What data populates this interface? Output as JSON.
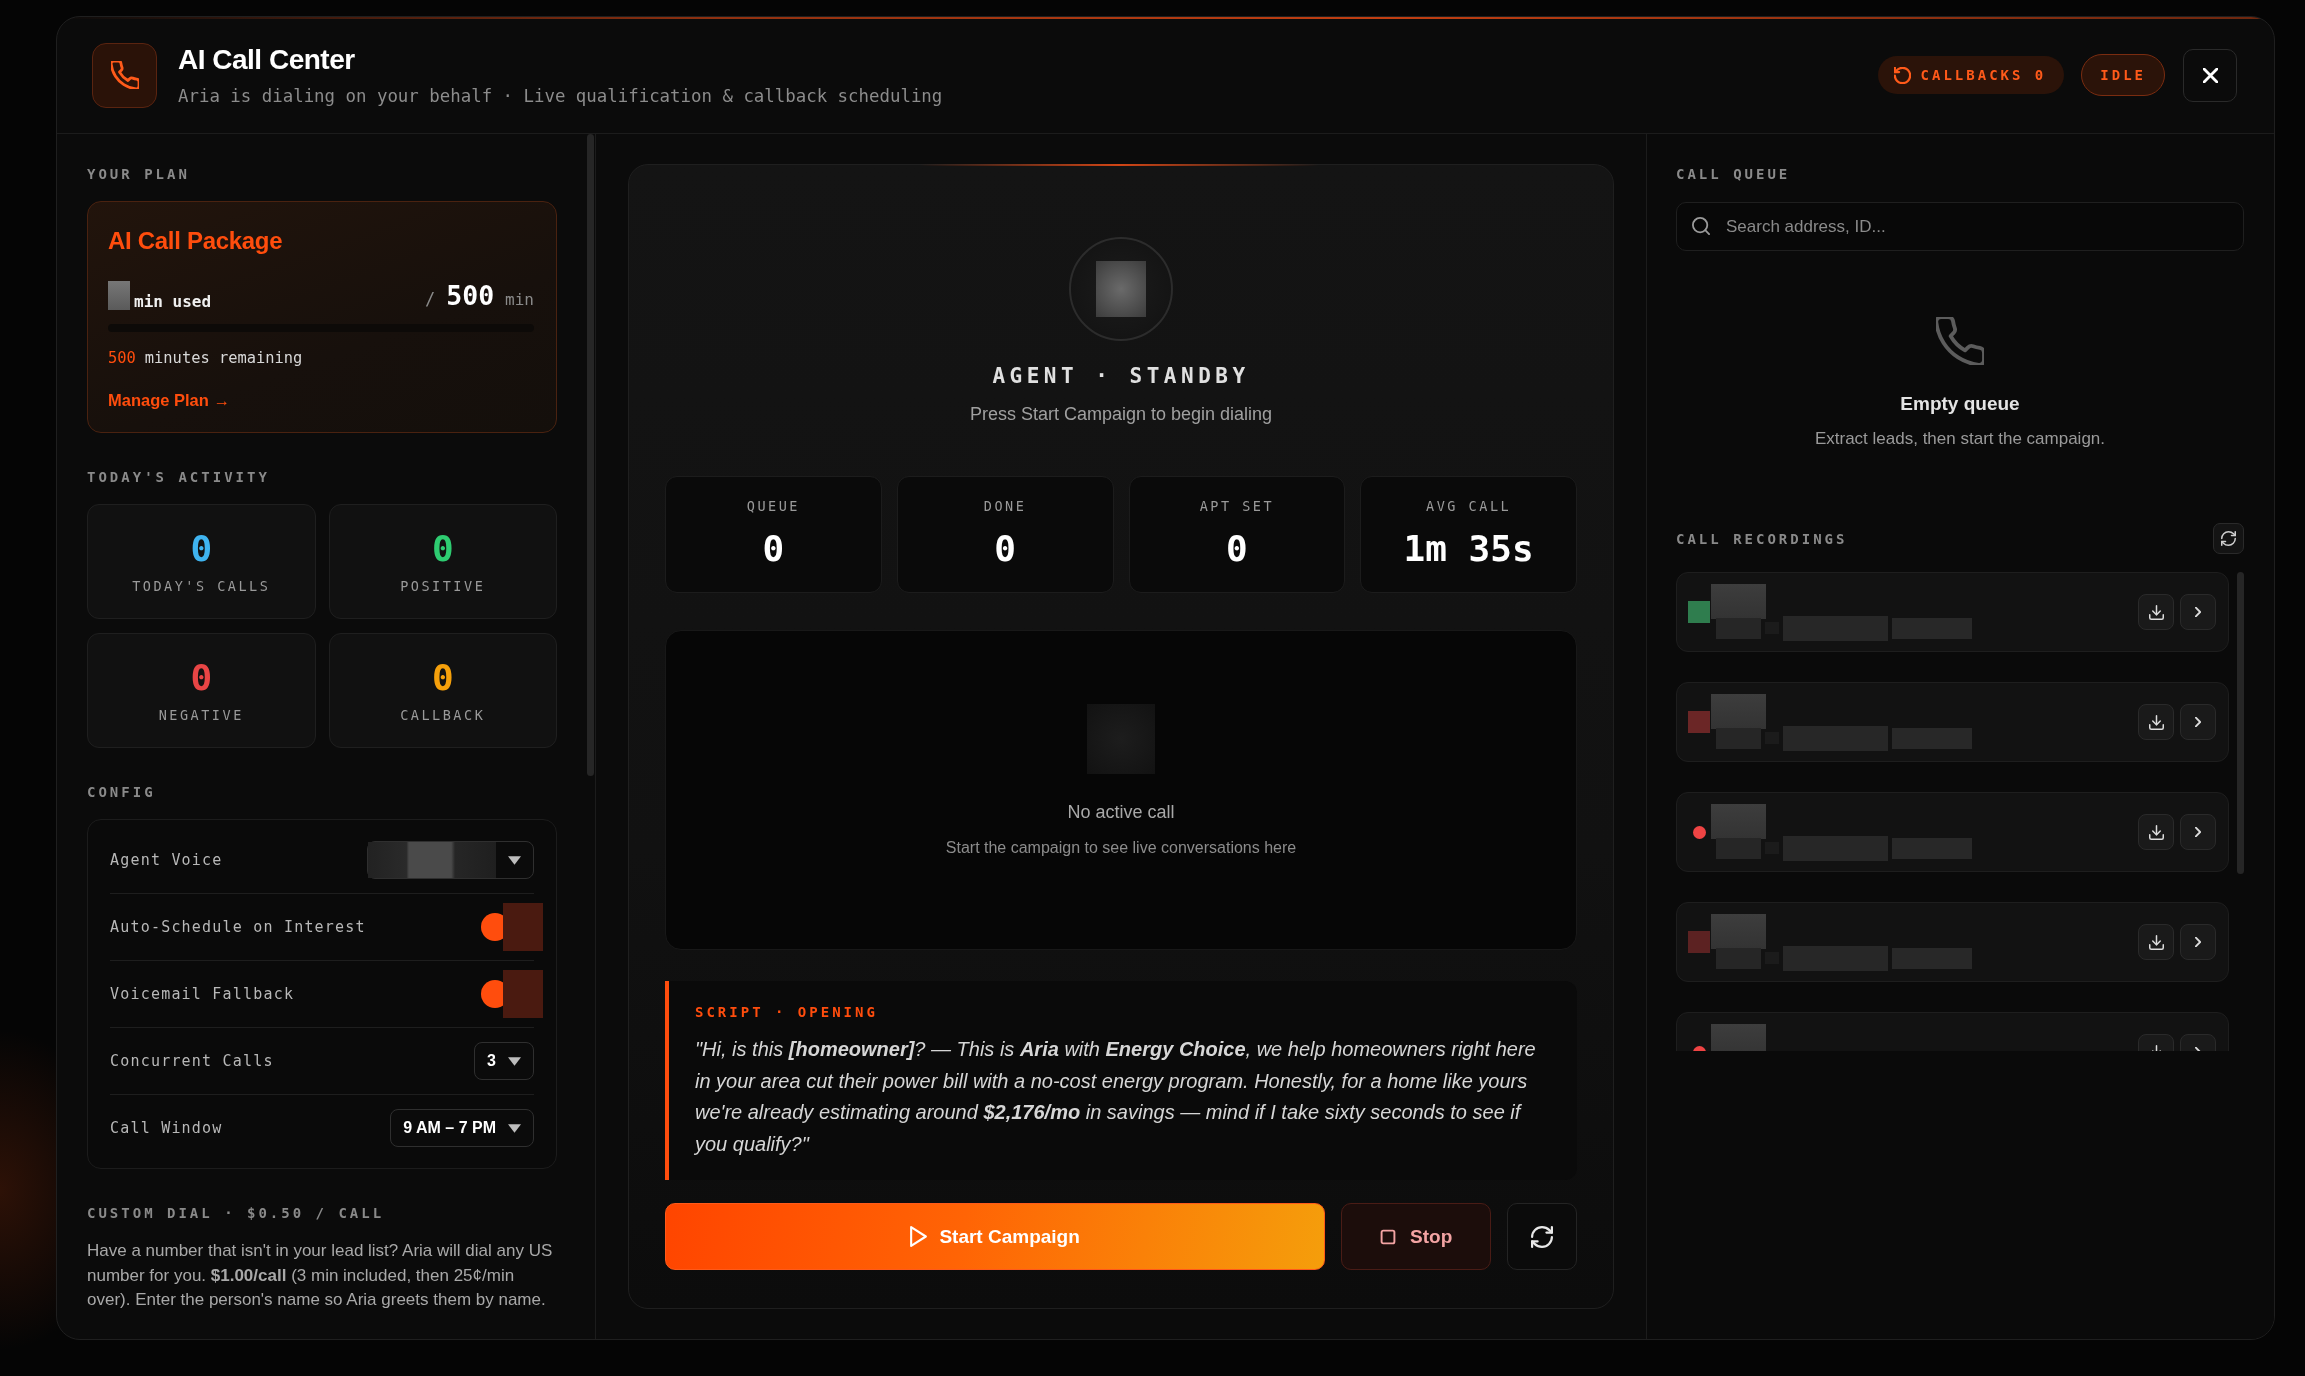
{
  "header": {
    "title": "AI Call Center",
    "subtitle": "Aria is dialing on your behalf · Live qualification & callback scheduling",
    "callbacks": "CALLBACKS 0",
    "status": "IDLE"
  },
  "plan": {
    "section_label": "YOUR PLAN",
    "name": "AI Call Package",
    "used_label": "min used",
    "separator": "/",
    "total": "500",
    "unit": "min",
    "level": 0,
    "remaining_count": "500",
    "remaining_label": "minutes remaining",
    "link": "Manage Plan →"
  },
  "activity": {
    "section_label": "TODAY'S ACTIVITY",
    "stats": [
      {
        "value": "0",
        "label": "TODAY'S CALLS",
        "color": "#3fb4f0"
      },
      {
        "value": "0",
        "label": "POSITIVE",
        "color": "#2ecc71"
      },
      {
        "value": "0",
        "label": "NEGATIVE",
        "color": "#e84545"
      },
      {
        "value": "0",
        "label": "CALLBACK",
        "color": "#f5a00b"
      }
    ]
  },
  "config": {
    "section_label": "CONFIG",
    "rows": [
      {
        "kind": "select",
        "label": "Agent Voice"
      },
      {
        "kind": "toggle",
        "label": "Auto-Schedule on Interest",
        "on": true
      },
      {
        "kind": "toggle",
        "label": "Voicemail Fallback",
        "on": true
      },
      {
        "kind": "select",
        "label": "Concurrent Calls",
        "value": "3"
      },
      {
        "kind": "select",
        "label": "Call Window",
        "value": "9 AM – 7 PM"
      }
    ]
  },
  "custom_dial": {
    "section_label": "CUSTOM DIAL · $0.50 / CALL",
    "description": "Have a number that isn't in your lead list? Aria will dial any US number for you. **$1.00/call** (3 min included, then 25¢/min over). Enter the person's name so Aria greets them by name."
  },
  "agent": {
    "status": "AGENT · STANDBY",
    "hint": "Press Start Campaign to begin dialing"
  },
  "metrics": [
    {
      "label": "QUEUE",
      "value": "0"
    },
    {
      "label": "DONE",
      "value": "0"
    },
    {
      "label": "APT SET",
      "value": "0"
    },
    {
      "label": "AVG CALL",
      "value": "1m 35s"
    }
  ],
  "live_call": {
    "title": "No active call",
    "hint": "Start the campaign to see live conversations here"
  },
  "script": {
    "label": "SCRIPT · OPENING",
    "text": "\"Hi, is this **[homeowner]**? — This is **Aria** with **Energy Choice**, we help homeowners right here in your area cut their power bill with a no-cost energy program. Honestly, for a home like yours we're already estimating around **$2,176/mo** in savings — mind if I take sixty seconds to see if you qualify?\""
  },
  "actions": [
    {
      "kind": "start",
      "label": "Start Campaign"
    },
    {
      "kind": "stop",
      "label": "Stop"
    },
    {
      "kind": "reset"
    }
  ],
  "queue": {
    "section_label": "CALL QUEUE",
    "search_placeholder": "Search address, ID...",
    "empty_title": "Empty queue",
    "empty_hint": "Extract leads, then start the campaign."
  },
  "recordings": {
    "section_label": "CALL RECORDINGS",
    "items": [
      {
        "kind": "square",
        "color": "#2f7d4e"
      },
      {
        "kind": "square",
        "color": "#6b2626"
      },
      {
        "kind": "dot",
        "color": "#ef4444"
      },
      {
        "kind": "square",
        "color": "#5c2222"
      },
      {
        "kind": "dot",
        "color": "#ef4444"
      }
    ]
  }
}
